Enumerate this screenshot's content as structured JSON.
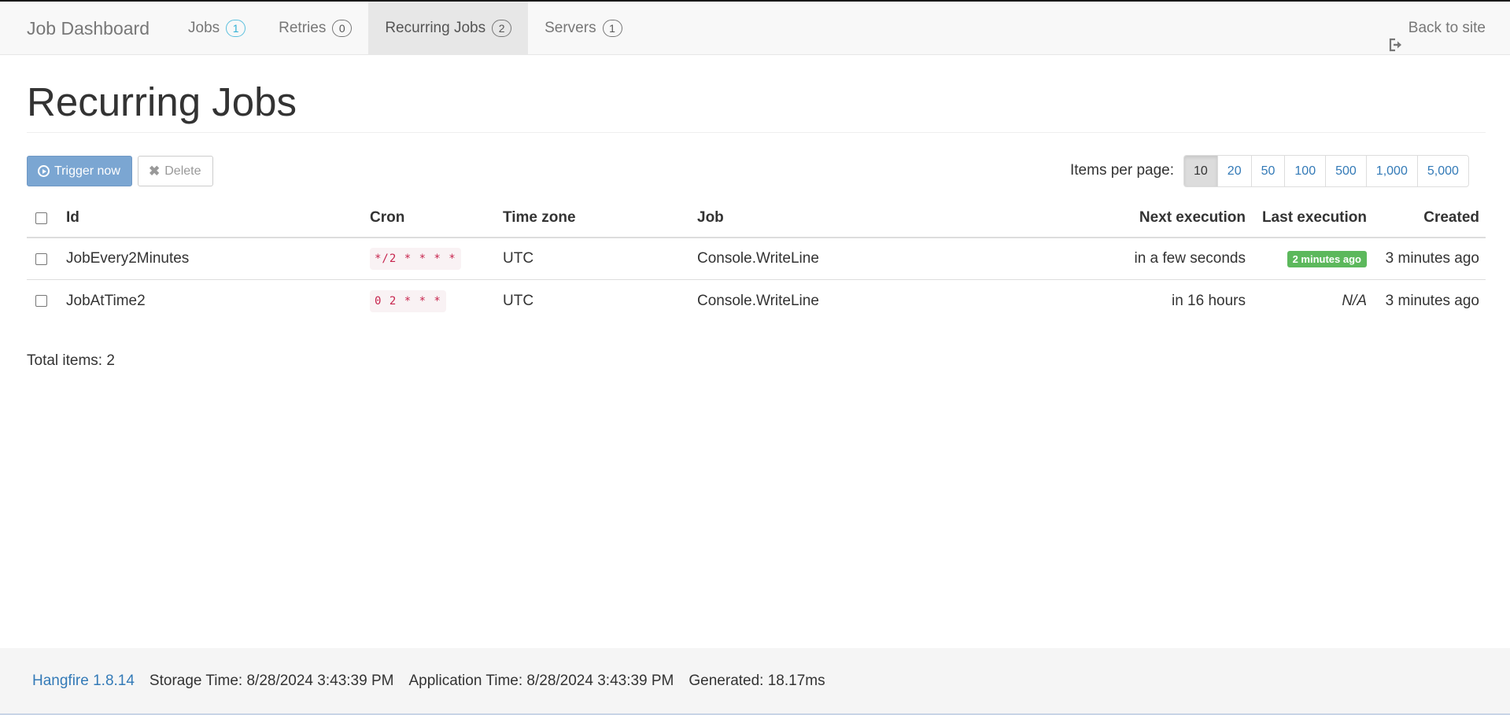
{
  "navbar": {
    "brand": "Job Dashboard",
    "items": [
      {
        "label": "Jobs",
        "count": "1"
      },
      {
        "label": "Retries",
        "count": "0"
      },
      {
        "label": "Recurring Jobs",
        "count": "2"
      },
      {
        "label": "Servers",
        "count": "1"
      }
    ],
    "back_label": "Back to site"
  },
  "page": {
    "title": "Recurring Jobs"
  },
  "toolbar": {
    "trigger_label": "Trigger now",
    "delete_label": "Delete",
    "items_per_page_label": "Items per page:",
    "page_sizes": [
      "10",
      "20",
      "50",
      "100",
      "500",
      "1,000",
      "5,000"
    ],
    "selected_page_size": "10"
  },
  "table": {
    "headers": {
      "id": "Id",
      "cron": "Cron",
      "timezone": "Time zone",
      "job": "Job",
      "next_execution": "Next execution",
      "last_execution": "Last execution",
      "created": "Created"
    },
    "rows": [
      {
        "id": "JobEvery2Minutes",
        "cron": "*/2 * * * *",
        "timezone": "UTC",
        "job": "Console.WriteLine",
        "next_execution": "in a few seconds",
        "last_execution": "2 minutes ago",
        "created": "3 minutes ago"
      },
      {
        "id": "JobAtTime2",
        "cron": "0 2 * * *",
        "timezone": "UTC",
        "job": "Console.WriteLine",
        "next_execution": "in 16 hours",
        "last_execution": "N/A",
        "created": "3 minutes ago"
      }
    ],
    "total_label": "Total items: 2"
  },
  "footer": {
    "version": "Hangfire 1.8.14",
    "storage_time": "Storage Time: 8/28/2024 3:43:39 PM",
    "application_time": "Application Time: 8/28/2024 3:43:39 PM",
    "generated": "Generated: 18.17ms"
  },
  "colors": {
    "success": "#5cb85c",
    "primary": "#7ba6d2",
    "link": "#337ab7"
  }
}
